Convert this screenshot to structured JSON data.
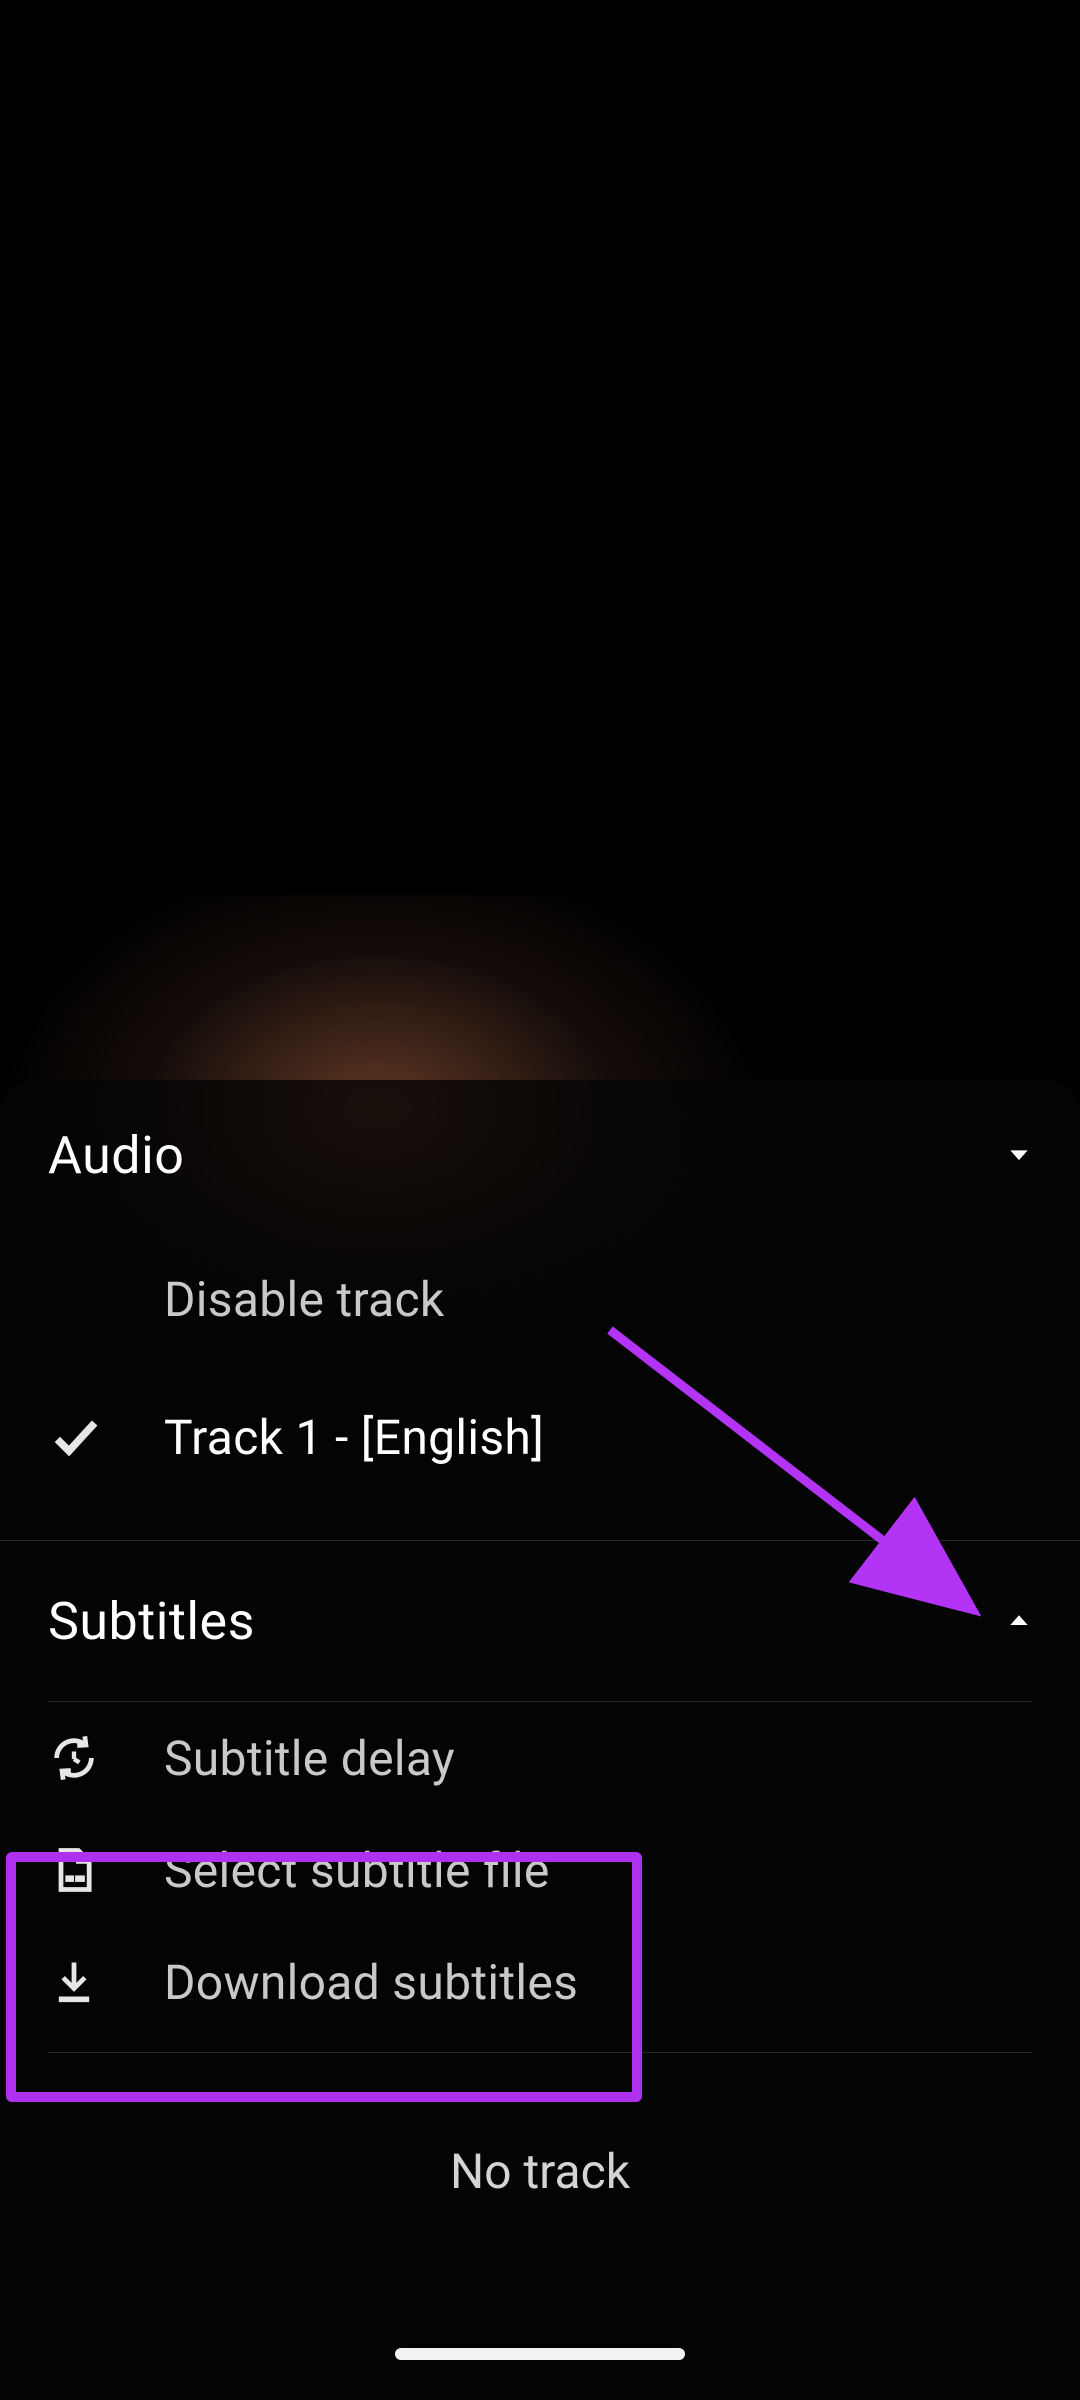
{
  "audio": {
    "title": "Audio",
    "disable_label": "Disable track",
    "tracks": [
      {
        "label": "Track 1 - [English]",
        "selected": true
      }
    ]
  },
  "subtitles": {
    "title": "Subtitles",
    "delay_label": "Subtitle delay",
    "select_file_label": "Select subtitle file",
    "download_label": "Download subtitles",
    "no_track_label": "No track"
  }
}
